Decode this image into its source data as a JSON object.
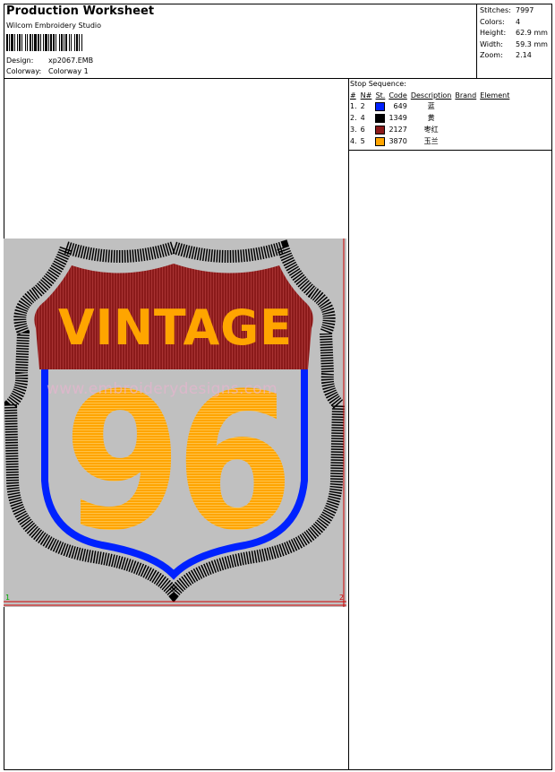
{
  "header": {
    "title": "Production Worksheet",
    "company": "Wilcom  Embroidery Studio",
    "design_label": "Design:",
    "design_value": "xp2067.EMB",
    "colorway_label": "Colorway:",
    "colorway_value": "Colorway  1"
  },
  "stats": [
    {
      "label": "Stitches:",
      "value": "7997"
    },
    {
      "label": "Colors:",
      "value": "4"
    },
    {
      "label": "Height:",
      "value": "62.9 mm"
    },
    {
      "label": "Width:",
      "value": "59.3 mm"
    },
    {
      "label": "Zoom:",
      "value": "2.14"
    }
  ],
  "stop_sequence": {
    "title": "Stop Sequence:",
    "columns": [
      "#",
      "N#",
      "St.",
      "Code",
      "Description",
      "Brand",
      "Element"
    ],
    "rows": [
      {
        "num": "1.",
        "n": "2",
        "code": "649",
        "color": "#0022ff",
        "desc": "蓝"
      },
      {
        "num": "2.",
        "n": "4",
        "code": "1349",
        "color": "#000000",
        "desc": "黄"
      },
      {
        "num": "3.",
        "n": "6",
        "code": "2127",
        "color": "#8b1a1a",
        "desc": "枣红"
      },
      {
        "num": "4.",
        "n": "5",
        "code": "3870",
        "color": "#ffa500",
        "desc": "玉兰"
      }
    ]
  },
  "design": {
    "top_text": "VINTAGE",
    "number_text": "96",
    "watermark": "www.embroiderydesigns.com",
    "corner_marks": [
      "1",
      "2"
    ],
    "colors": {
      "background": "#c0c0c0",
      "maroon": "#8b1a1a",
      "orange": "#ffa500",
      "blue": "#0022ff",
      "black": "#000000"
    }
  }
}
